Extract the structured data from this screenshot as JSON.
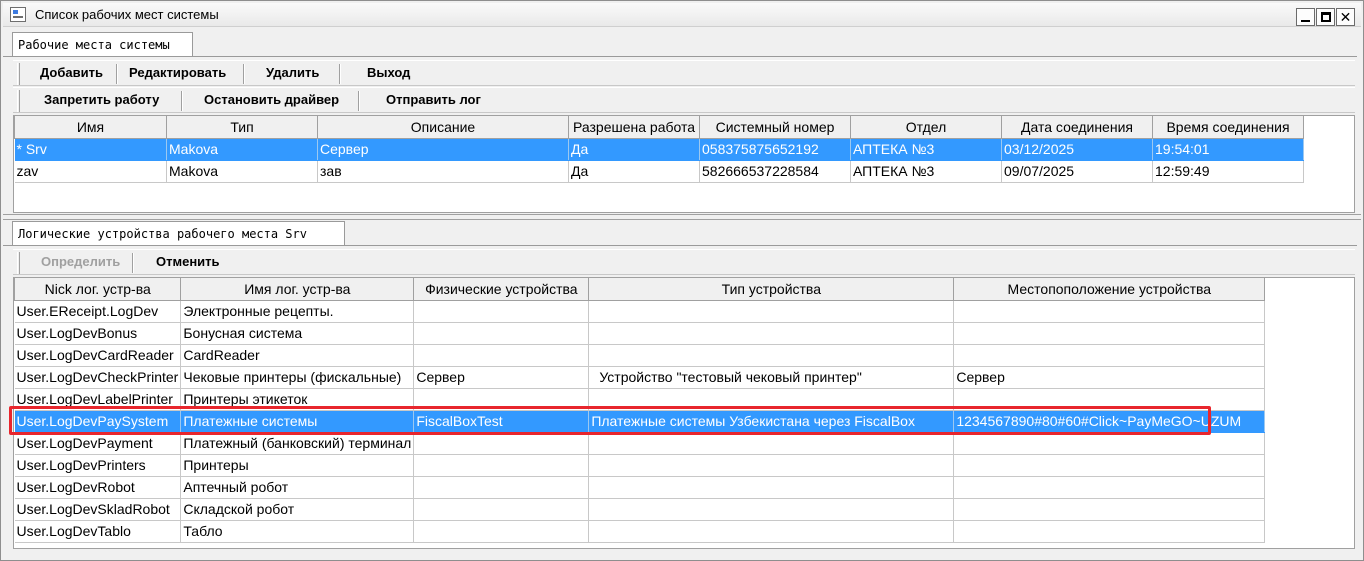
{
  "window": {
    "title": "Список рабочих мест системы",
    "min_glyph": "",
    "max_glyph": "",
    "close_glyph": "✕"
  },
  "top_tab": {
    "label": "Рабочие места системы"
  },
  "toolbar1": {
    "add": "Добавить",
    "edit": "Редактировать",
    "delete": "Удалить",
    "exit": "Выход"
  },
  "toolbar2": {
    "block": "Запретить работу",
    "stop_driver": "Остановить драйвер",
    "send_log": "Отправить лог"
  },
  "workstations": {
    "columns": [
      "Имя",
      "Тип",
      "Описание",
      "Разрешена работа",
      "Системный номер",
      "Отдел",
      "Дата соединения",
      "Время соединения"
    ],
    "rows": [
      [
        "* Srv",
        "Makova",
        "Сервер",
        "Да",
        "058375875652192",
        "АПТЕКА  №3",
        "03/12/2025",
        "19:54:01"
      ],
      [
        "zav",
        "Makova",
        "зав",
        "Да",
        "582666537228584",
        "АПТЕКА  №3",
        "09/07/2025",
        "12:59:49"
      ]
    ],
    "selected_row": 0
  },
  "bottom_tab": {
    "label": "Логические устройства рабочего места Srv"
  },
  "toolbar3": {
    "define": "Определить",
    "cancel": "Отменить"
  },
  "devices": {
    "columns": [
      "Nick лог. устр-ва",
      "Имя лог. устр-ва",
      "Физические устройства",
      "Тип устройства",
      "Местопоположение устройства"
    ],
    "rows": [
      [
        "User.EReceipt.LogDev",
        "Электронные рецепты.",
        "",
        "",
        ""
      ],
      [
        "User.LogDevBonus",
        "Бонусная система",
        "",
        "",
        ""
      ],
      [
        "User.LogDevCardReader",
        "CardReader",
        "",
        "",
        ""
      ],
      [
        "User.LogDevCheckPrinter",
        "Чековые принтеры (фискальные)",
        "Сервер",
        "Устройство \"тестовый чековый принтер\"",
        "Сервер"
      ],
      [
        "User.LogDevLabelPrinter",
        "Принтеры этикеток",
        "",
        "",
        ""
      ],
      [
        "User.LogDevPaySystem",
        "Платежные системы",
        "FiscalBoxTest",
        "Платежные системы Узбекистана через FiscalBox",
        "1234567890#80#60#Click~PayMeGO~UZUM"
      ],
      [
        "User.LogDevPayment",
        "Платежный (банковский) терминал",
        "",
        "",
        ""
      ],
      [
        "User.LogDevPrinters",
        "Принтеры",
        "",
        "",
        ""
      ],
      [
        "User.LogDevRobot",
        "Аптечный робот",
        "",
        "",
        ""
      ],
      [
        "User.LogDevSkladRobot",
        "Складской робот",
        "",
        "",
        ""
      ],
      [
        "User.LogDevTablo",
        "Табло",
        "",
        "",
        ""
      ]
    ],
    "selected_row": 5
  },
  "colors": {
    "selection": "#3399ff",
    "highlight_box": "#e8262d"
  }
}
